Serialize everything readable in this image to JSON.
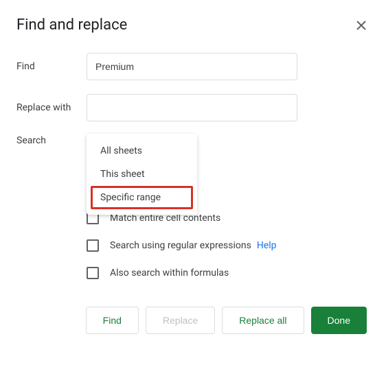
{
  "dialog": {
    "title": "Find and replace"
  },
  "form": {
    "find_label": "Find",
    "find_value": "Premium",
    "replace_label": "Replace with",
    "replace_value": "",
    "search_label": "Search"
  },
  "dropdown": {
    "items": [
      "All sheets",
      "This sheet",
      "Specific range"
    ]
  },
  "checkboxes": {
    "match_entire": "Match entire cell contents",
    "regex": "Search using regular expressions",
    "help": "Help",
    "formulas": "Also search within formulas"
  },
  "buttons": {
    "find": "Find",
    "replace": "Replace",
    "replace_all": "Replace all",
    "done": "Done"
  }
}
